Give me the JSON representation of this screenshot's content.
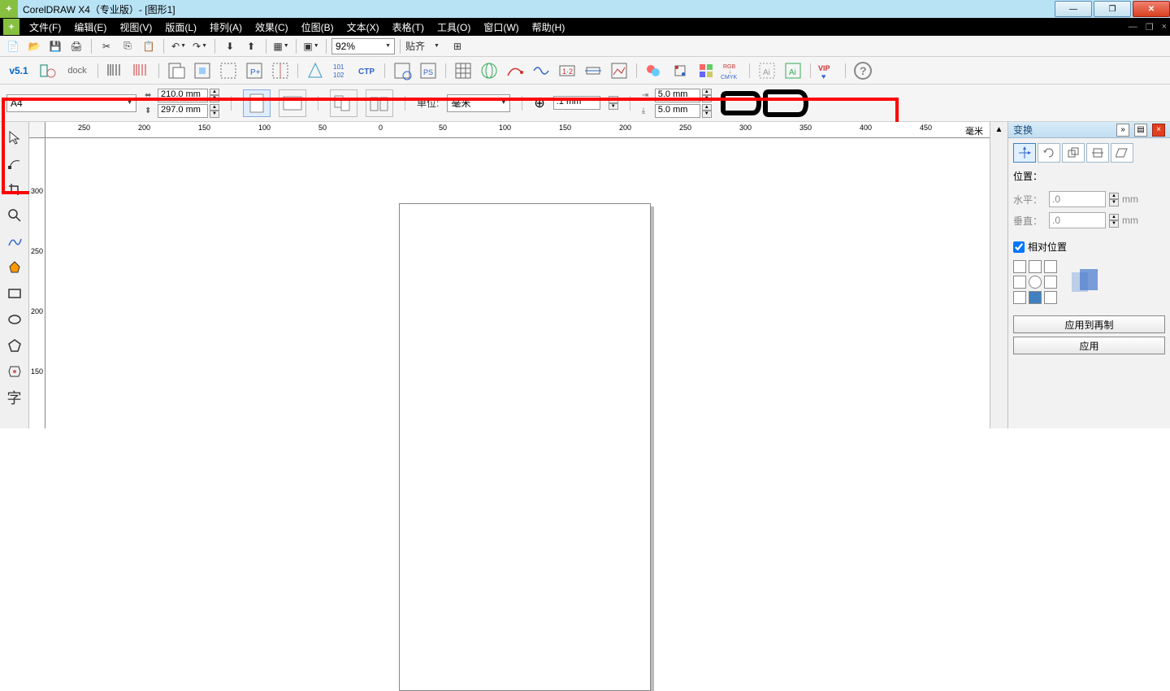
{
  "titlebar": {
    "app_title": "CorelDRAW X4（专业版）- [图形1]"
  },
  "menubar": {
    "items": [
      "文件(F)",
      "编辑(E)",
      "视图(V)",
      "版面(L)",
      "排列(A)",
      "效果(C)",
      "位图(B)",
      "文本(X)",
      "表格(T)",
      "工具(O)",
      "窗口(W)",
      "帮助(H)"
    ]
  },
  "toolbar": {
    "zoom": "92%",
    "snap_label": "贴齐"
  },
  "plugin": {
    "version": "v5.1",
    "dock": "dock"
  },
  "propbar": {
    "paper": "A4",
    "width": "210.0 mm",
    "height": "297.0 mm",
    "unit_label": "单位:",
    "unit": "毫米",
    "nudge": ".1 mm",
    "dup_x": "5.0 mm",
    "dup_y": "5.0 mm"
  },
  "ruler": {
    "h_ticks": [
      "250",
      "200",
      "150",
      "100",
      "50",
      "0",
      "50",
      "100",
      "150",
      "200",
      "250",
      "300",
      "350",
      "400",
      "450"
    ],
    "unit_mark": "毫米",
    "v_ticks": [
      "300",
      "250",
      "200",
      "150"
    ]
  },
  "docker": {
    "title": "变换",
    "section": "位置：",
    "h_label": "水平：",
    "v_label": "垂直：",
    "h_value": ".0",
    "v_value": ".0",
    "unit": "mm",
    "relative": "相对位置",
    "apply_dup": "应用到再制",
    "apply": "应用"
  }
}
